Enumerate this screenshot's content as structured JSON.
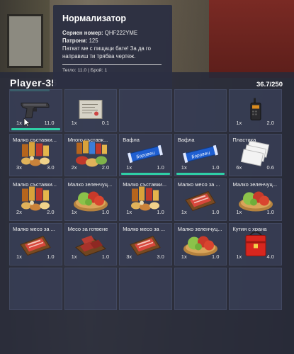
{
  "inventory": {
    "player_name": "Player-35",
    "weight": "36.7/250"
  },
  "tooltip": {
    "title": "Нормализатор",
    "serial_label": "Сериен номер:",
    "serial_value": "QHF222YME",
    "ammo_label": "Патрони:",
    "ammo_value": "125",
    "description": "Паткат ме с пищаци бате! За да го направиш ти трябва чертеж.",
    "footer": "Тегло: 11.0 | Брой: 1"
  },
  "slots": [
    {
      "name": "",
      "count": "1x",
      "weight": "11.0",
      "icon": "pistol-icon",
      "bar": true
    },
    {
      "name": "",
      "count": "1x",
      "weight": "0.1",
      "icon": "blueprint-icon",
      "bar": false
    },
    {
      "name": "",
      "count": "",
      "weight": "",
      "icon": "",
      "bar": false
    },
    {
      "name": "",
      "count": "",
      "weight": "",
      "icon": "",
      "bar": false
    },
    {
      "name": "",
      "count": "1x",
      "weight": "2.0",
      "icon": "radio-icon",
      "bar": false
    },
    {
      "name": "Малко съставки...",
      "count": "3x",
      "weight": "3.0",
      "icon": "ingredients-icon",
      "bar": false
    },
    {
      "name": "Много съставк...",
      "count": "2x",
      "weight": "2.0",
      "icon": "ingredients-large-icon",
      "bar": false
    },
    {
      "name": "Вафла",
      "count": "1x",
      "weight": "1.0",
      "icon": "wafer-icon",
      "bar": true
    },
    {
      "name": "Вафла",
      "count": "1x",
      "weight": "1.0",
      "icon": "wafer-icon",
      "bar": true
    },
    {
      "name": "Пластика",
      "count": "6x",
      "weight": "0.6",
      "icon": "plastic-cards-icon",
      "bar": false
    },
    {
      "name": "Малко съставки...",
      "count": "2x",
      "weight": "2.0",
      "icon": "ingredients-icon",
      "bar": false
    },
    {
      "name": "Малко зеленчуц...",
      "count": "1x",
      "weight": "1.0",
      "icon": "vegetables-icon",
      "bar": false
    },
    {
      "name": "Малко съставки...",
      "count": "1x",
      "weight": "1.0",
      "icon": "ingredients-icon",
      "bar": false
    },
    {
      "name": "Малко месо за ...",
      "count": "1x",
      "weight": "1.0",
      "icon": "meat-board-icon",
      "bar": false
    },
    {
      "name": "Малко зеленчуц...",
      "count": "1x",
      "weight": "1.0",
      "icon": "vegetables-icon",
      "bar": false
    },
    {
      "name": "Малко месо за ...",
      "count": "1x",
      "weight": "1.0",
      "icon": "meat-board-icon",
      "bar": false
    },
    {
      "name": "Месо за готвене",
      "count": "1x",
      "weight": "1.0",
      "icon": "cooking-meat-icon",
      "bar": false
    },
    {
      "name": "Малко месо за ...",
      "count": "3x",
      "weight": "3.0",
      "icon": "meat-board-icon",
      "bar": false
    },
    {
      "name": "Малко зеленчуц...",
      "count": "1x",
      "weight": "1.0",
      "icon": "vegetables-icon",
      "bar": false
    },
    {
      "name": "Кутия с храна",
      "count": "1x",
      "weight": "4.0",
      "icon": "food-bag-icon",
      "bar": false
    },
    {
      "name": "",
      "count": "",
      "weight": "",
      "icon": "",
      "bar": false
    },
    {
      "name": "",
      "count": "",
      "weight": "",
      "icon": "",
      "bar": false
    },
    {
      "name": "",
      "count": "",
      "weight": "",
      "icon": "",
      "bar": false
    },
    {
      "name": "",
      "count": "",
      "weight": "",
      "icon": "",
      "bar": false
    },
    {
      "name": "",
      "count": "",
      "weight": "",
      "icon": "",
      "bar": false
    }
  ],
  "colors": {
    "accent": "#2fcfa6",
    "panel": "#262a3a",
    "tooltip": "#2c3042"
  }
}
